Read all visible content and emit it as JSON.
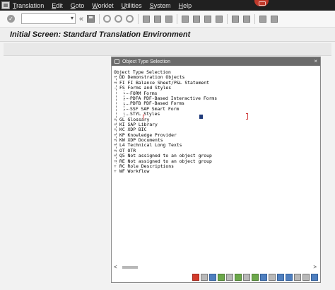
{
  "menu": {
    "items": [
      "Translation",
      "Edit",
      "Goto",
      "Worklet",
      "Utilities",
      "System",
      "Help"
    ]
  },
  "toolbar": {
    "command_value": "",
    "back_chevron": "«"
  },
  "title": {
    "text": "Initial Screen: Standard Translation Environment"
  },
  "popup": {
    "title": "Object Type Selection",
    "close_glyph": "×",
    "tree": {
      "root": "Object Type Selection",
      "nodes": [
        {
          "label": "DD Demonstration Objects",
          "level": 1,
          "expander": "+"
        },
        {
          "label": "FI FI Balance Sheet/P&L Statement",
          "level": 1,
          "expander": "+"
        },
        {
          "label": "FS Forms and Styles",
          "level": 1,
          "expander": "-"
        },
        {
          "label": "FORM Forms",
          "level": 2,
          "expander": ""
        },
        {
          "label": "PDFA PDF-Based Interactive Forms",
          "level": 2,
          "expander": ""
        },
        {
          "label": "PDFB PDF-Based Forms",
          "level": 2,
          "expander": ""
        },
        {
          "label": "SSF  SAP Smart Form",
          "level": 2,
          "expander": ""
        },
        {
          "label": "STYL Styles",
          "level": 2,
          "expander": ""
        },
        {
          "label": "GL Glossary",
          "level": 1,
          "expander": "+"
        },
        {
          "label": "KI SAP Library",
          "level": 1,
          "expander": "+"
        },
        {
          "label": "KC XDP BIC",
          "level": 1,
          "expander": "+"
        },
        {
          "label": "KP Knowledge Provider",
          "level": 1,
          "expander": "+"
        },
        {
          "label": "KW XDP Documents",
          "level": 1,
          "expander": "+"
        },
        {
          "label": "L4 Technical Long Texts",
          "level": 1,
          "expander": "+"
        },
        {
          "label": "OT OTR",
          "level": 1,
          "expander": "+"
        },
        {
          "label": "Q5 Not assigned to an object group",
          "level": 1,
          "expander": "+"
        },
        {
          "label": "RE Not assigned to an object group",
          "level": 1,
          "expander": "+"
        },
        {
          "label": "RC Role Descriptions",
          "level": 1,
          "expander": "+"
        },
        {
          "label": "WF Workflow",
          "level": 1,
          "expander": "+"
        }
      ]
    },
    "scroll": {
      "left": "<",
      "right": ">"
    }
  },
  "colors": {
    "menubar": "#202020",
    "popup_title": "#6b6b6b",
    "close_red": "#c0392b",
    "selection_cursor": "#1f3a7a"
  }
}
